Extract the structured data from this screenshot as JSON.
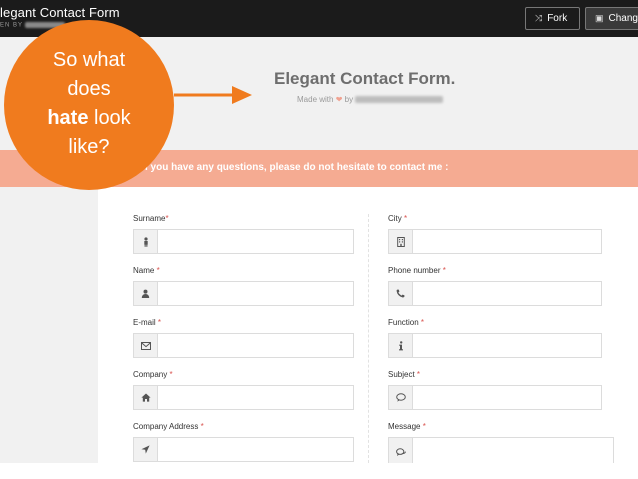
{
  "topbar": {
    "title": "legant Contact Form",
    "byline": "EN BY",
    "fork_label": "Fork",
    "change_label": "Chang"
  },
  "header": {
    "title": "Elegant Contact Form.",
    "made_with": "Made with",
    "by": "by"
  },
  "banner": {
    "text": "l you have any questions, please do not hesitate to contact me :"
  },
  "form": {
    "left": [
      {
        "label": "Surname",
        "icon": "user-icon"
      },
      {
        "label": "Name",
        "icon": "person-icon"
      },
      {
        "label": "E-mail",
        "icon": "envelope-icon"
      },
      {
        "label": "Company",
        "icon": "home-icon"
      },
      {
        "label": "Company Address",
        "icon": "location-arrow-icon"
      }
    ],
    "right": [
      {
        "label": "City",
        "icon": "building-icon"
      },
      {
        "label": "Phone number",
        "icon": "phone-icon"
      },
      {
        "label": "Function",
        "icon": "info-icon"
      },
      {
        "label": "Subject",
        "icon": "comment-icon"
      },
      {
        "label": "Message",
        "icon": "comments-icon"
      }
    ],
    "required_mark": "*"
  },
  "callout": {
    "line1": "So what",
    "line2": "does",
    "line3_bold": "hate",
    "line3_rest": " look",
    "line4": "like?",
    "color": "#f07b1e"
  },
  "colors": {
    "banner": "#f5ab92",
    "topbar": "#1b1b1b",
    "required": "#d9534f"
  }
}
